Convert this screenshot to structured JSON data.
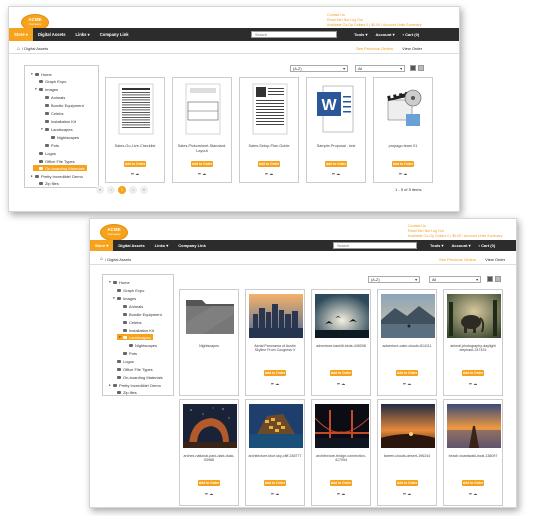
{
  "brand": {
    "logo_text": "ACME",
    "logo_sub": "Company",
    "accent": "#f7a21b",
    "nav_bg": "#2c2c2c"
  },
  "top_links": [
    "Contact Us",
    "Read Me! Not Log Out",
    "Available Co-Op Dollars 0 | $0.00 / Account Units Summary"
  ],
  "nav": {
    "store": "Store",
    "digital_assets": "Digital Assets",
    "links": "Links",
    "company_link": "Company Link",
    "search_placeholder": "Search",
    "tools": "Tools",
    "account": "Account",
    "cart": "Cart (0)"
  },
  "breadcrumb": {
    "home_icon": "home-icon",
    "path": "/ Digital Assets"
  },
  "actions": {
    "previous_orders": "See Previous Orders",
    "view_order": "View Order"
  },
  "filters": {
    "sort": "(A-Z)",
    "filter": "All"
  },
  "tree": [
    "Home",
    "Graph Expo",
    "Images",
    "Animals",
    "Bundle Equipment",
    "Celebs",
    "Installation Kit",
    "Landscapes",
    "Nightscapes",
    "Pots",
    "Logos",
    "Office File Types",
    "On-boarding Materials",
    "Pretty Incredible! Demo",
    "Zip files"
  ],
  "screen1": {
    "selected_tree": "On-boarding Materials",
    "cards": [
      {
        "label": "Sales-Go-Live-Checklist",
        "thumb": "doc",
        "add": "Add to Order"
      },
      {
        "label": "Sales-Pickorsheet-Standard-Layout",
        "thumb": "label",
        "add": "Add to Order"
      },
      {
        "label": "Sales-Setup-Plan-Guide",
        "thumb": "doc2",
        "add": "Add to Order"
      },
      {
        "label": "Sample-Proposal - test",
        "thumb": "word",
        "add": "Add to Order"
      },
      {
        "label": "propago team 01",
        "thumb": "media",
        "add": "Add to Order"
      }
    ],
    "pagination": {
      "pages": [
        "«",
        "‹",
        "1",
        "›",
        "»"
      ],
      "current": "1"
    },
    "count_text": "1 - 5 of 5 items"
  },
  "screen2": {
    "selected_tree": "Landscapes",
    "cards": [
      {
        "label": "Nightscapes",
        "thumb": "folder",
        "add": ""
      },
      {
        "label": "Aerial Panorama of Austin Skyline From Congress V",
        "thumb": "city",
        "add": "Add to Order"
      },
      {
        "label": "adventure-backlit-birds-445008",
        "thumb": "birds",
        "add": "Add to Order"
      },
      {
        "label": "adventure-calm-clouds-814111",
        "thumb": "calm",
        "add": "Add to Order"
      },
      {
        "label": "animal-photography-daylight elephant-247431",
        "thumb": "elephant",
        "add": "Add to Order"
      },
      {
        "label": "arches-national-park-dark-dusk-53988",
        "thumb": "arch",
        "add": "Add to Order"
      },
      {
        "label": "architecture-blue-sky-cliff-248777",
        "thumb": "cliff",
        "add": "Add to Order"
      },
      {
        "label": "architecture-bridge-connection-417054",
        "thumb": "bridge",
        "add": "Add to Order"
      },
      {
        "label": "barren-clouds-desert-196244",
        "thumb": "desert",
        "add": "Add to Order"
      },
      {
        "label": "beach-boardwalk-boat-138097",
        "thumb": "pier",
        "add": "Add to Order"
      }
    ]
  }
}
